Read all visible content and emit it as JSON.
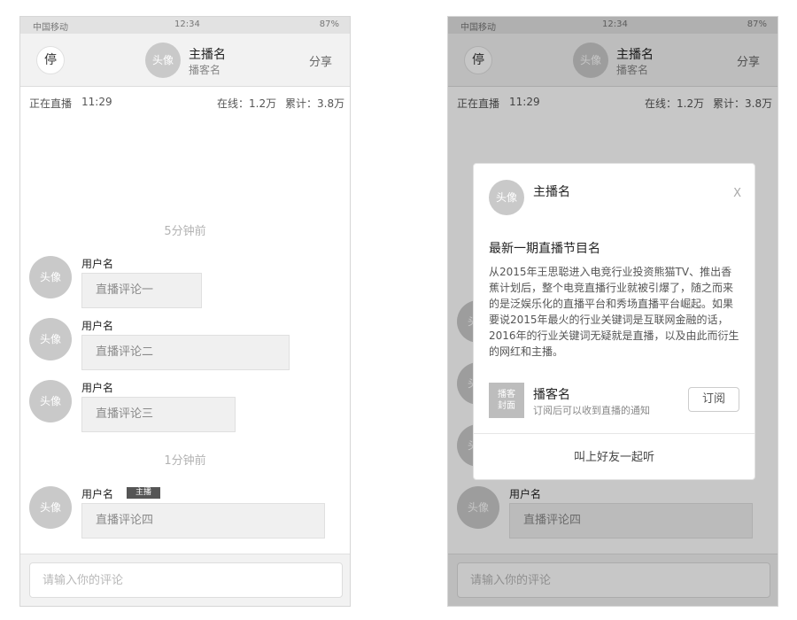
{
  "status_bar": {
    "carrier": "中国移动",
    "time": "12:34",
    "battery": "87%"
  },
  "header": {
    "stop_label": "停",
    "avatar_label": "头像",
    "host_name": "主播名",
    "podcast_name": "播客名",
    "share_label": "分享"
  },
  "live_info": {
    "status": "正在直播",
    "elapsed": "11:29",
    "online": "在线：1.2万",
    "total": "累计：3.8万"
  },
  "chat": {
    "dividers": [
      "5分钟前",
      "1分钟前"
    ],
    "avatar_label": "头像",
    "comments": [
      {
        "user": "用户名",
        "text": "直播评论一"
      },
      {
        "user": "用户名",
        "text": "直播评论二"
      },
      {
        "user": "用户名",
        "text": "直播评论三"
      },
      {
        "user": "用户名",
        "text": "直播评论四",
        "tag": "主播"
      }
    ]
  },
  "input": {
    "placeholder": "请输入你的评论"
  },
  "modal": {
    "avatar_label": "头像",
    "host_name": "主播名",
    "close": "X",
    "title": "最新一期直播节目名",
    "description": "从2015年王思聪进入电竞行业投资熊猫TV、推出香蕉计划后，整个电竞直播行业就被引爆了，随之而来的是泛娱乐化的直播平台和秀场直播平台崛起。如果要说2015年最火的行业关键词是互联网金融的话，2016年的行业关键词无疑就是直播，以及由此而衍生的网红和主播。",
    "cover_line1": "播客",
    "cover_line2": "封面",
    "podcast_name": "播客名",
    "podcast_note": "订阅后可以收到直播的通知",
    "subscribe_label": "订阅",
    "invite_label": "叫上好友一起听"
  }
}
